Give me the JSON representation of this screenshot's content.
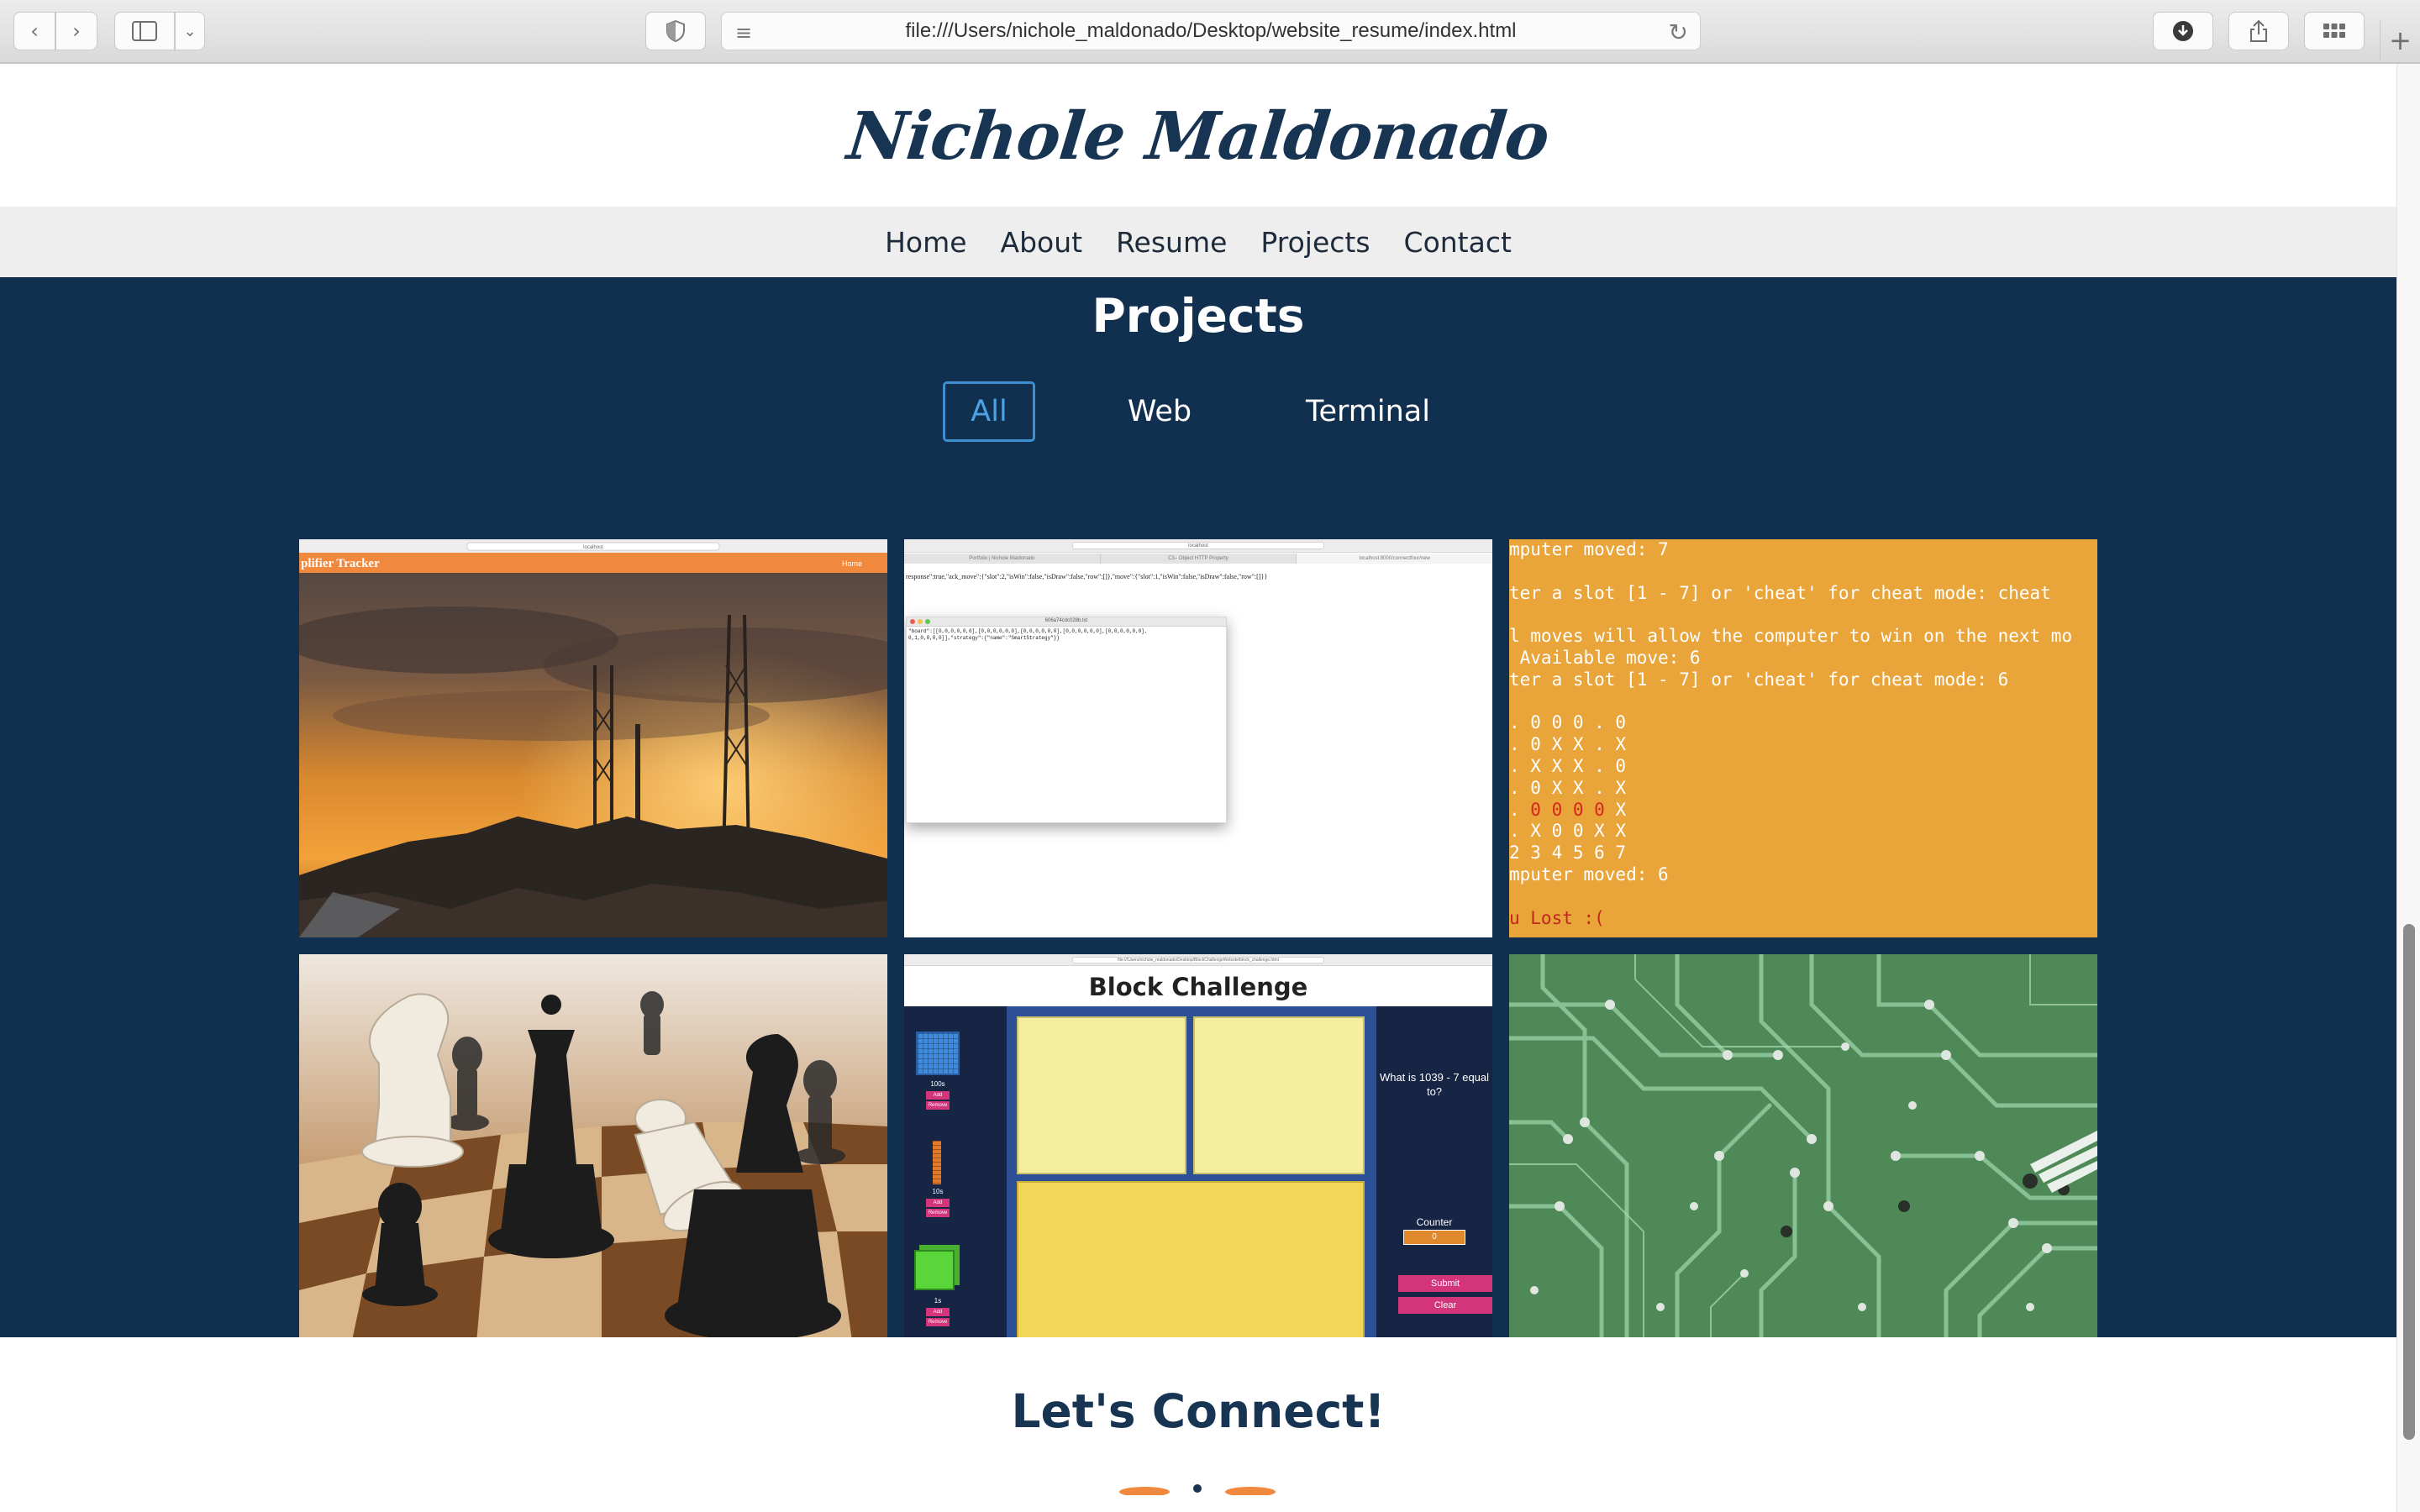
{
  "browser": {
    "url": "file:///Users/nichole_maldonado/Desktop/website_resume/index.html"
  },
  "site": {
    "title": "Nichole Maldonado",
    "nav": [
      "Home",
      "About",
      "Resume",
      "Projects",
      "Contact"
    ]
  },
  "projects": {
    "heading": "Projects",
    "filters": [
      "All",
      "Web",
      "Terminal"
    ],
    "active_filter": "All",
    "tiles": {
      "amplifier": {
        "header_title": "plifier Tracker",
        "header_link": "Home",
        "address": "localhost"
      },
      "connect4_web": {
        "address": "localhost",
        "tabs": [
          "Portfolio | Nichole Maldonado",
          "C3– Object HTTP Property",
          "localhost:8000/connectfour/new"
        ],
        "response_line": "response\":true,\"ack_move\":{\"slot\":2,\"isWin\":false,\"isDraw\":false,\"row\":[]},\"move\":{\"slot\":1,\"isWin\":false,\"isDraw\":false,\"row\":[]}}",
        "file_name": "606a74cdc028b.txt",
        "file_body": [
          "\"board\":[[0,0,0,0,0,0],[0,0,0,0,0,0],[0,0,0,0,0,0],[0,0,0,0,0,0],[0,0,0,0,0,0],",
          "0,1,0,0,0,0]],\"strategy\":{\"name\":\"SmartStrategy\"}}"
        ]
      },
      "terminal": {
        "lines": [
          "mputer moved: 7",
          "",
          "ter a slot [1 - 7] or 'cheat' for cheat mode: cheat",
          "",
          "l moves will allow the computer to win on the next mo",
          " Available move: 6",
          "ter a slot [1 - 7] or 'cheat' for cheat mode: 6",
          "",
          ". 0 0 0 . 0",
          ". 0 X X . X",
          ". X X X . 0",
          ". 0 X X . X",
          ". 0 0 0 0 X",
          ". X 0 0 X X",
          "2 3 4 5 6 7",
          "mputer moved: 6",
          "",
          "u Lost :("
        ],
        "highlight_line_index": 12,
        "highlight_text": "0 0 0 0"
      },
      "block_challenge": {
        "title": "Block Challenge",
        "address": "file:///Users/nichole_maldonado/Desktop/BlockChallengeWebsite/block_challenge.html",
        "blocks": [
          {
            "label": "100s",
            "add": "Add",
            "remove": "Remove"
          },
          {
            "label": "10s",
            "add": "Add",
            "remove": "Remove"
          },
          {
            "label": "1s",
            "add": "Add",
            "remove": "Remove"
          }
        ],
        "question": "What is 1039 - 7 equal to?",
        "counter_label": "Counter",
        "counter_value": "0",
        "submit": "Submit",
        "clear": "Clear"
      }
    }
  },
  "connect": {
    "heading": "Let's Connect!"
  },
  "colors": {
    "navy": "#11304f",
    "title_navy": "#173452",
    "accent_orange": "#f0883e",
    "terminal_orange": "#e9a43a",
    "active_blue": "#3d8fd0"
  }
}
